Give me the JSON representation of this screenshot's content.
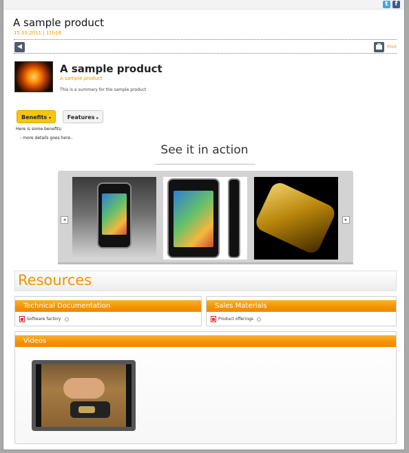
{
  "header": {
    "title": "A sample product",
    "date": "15.03.2011 | 11h16",
    "print_label": "Print"
  },
  "social": {
    "twitter": "t",
    "facebook": "f"
  },
  "product": {
    "title": "A sample product",
    "subtitle": "A sample product",
    "summary": "This is a summary for the sample product"
  },
  "tabs": [
    {
      "label": "Benefits",
      "arrow": "▾"
    },
    {
      "label": "Features",
      "arrow": "▸"
    }
  ],
  "benefits": {
    "intro": "Here is some benefits:",
    "detail": "- more details goes here.."
  },
  "gallery": {
    "title": "See it in action",
    "prev": "◂",
    "next": "▸"
  },
  "resources": {
    "title": "Resources",
    "technical": {
      "heading": "Technical Documentation",
      "item": "Software factory"
    },
    "sales": {
      "heading": "Sales Materials",
      "item": "Product offerings"
    },
    "videos": {
      "heading": "Videos"
    }
  },
  "colors": {
    "accent": "#f39200",
    "tab_active": "#f6c511",
    "button": "#505a6e"
  }
}
